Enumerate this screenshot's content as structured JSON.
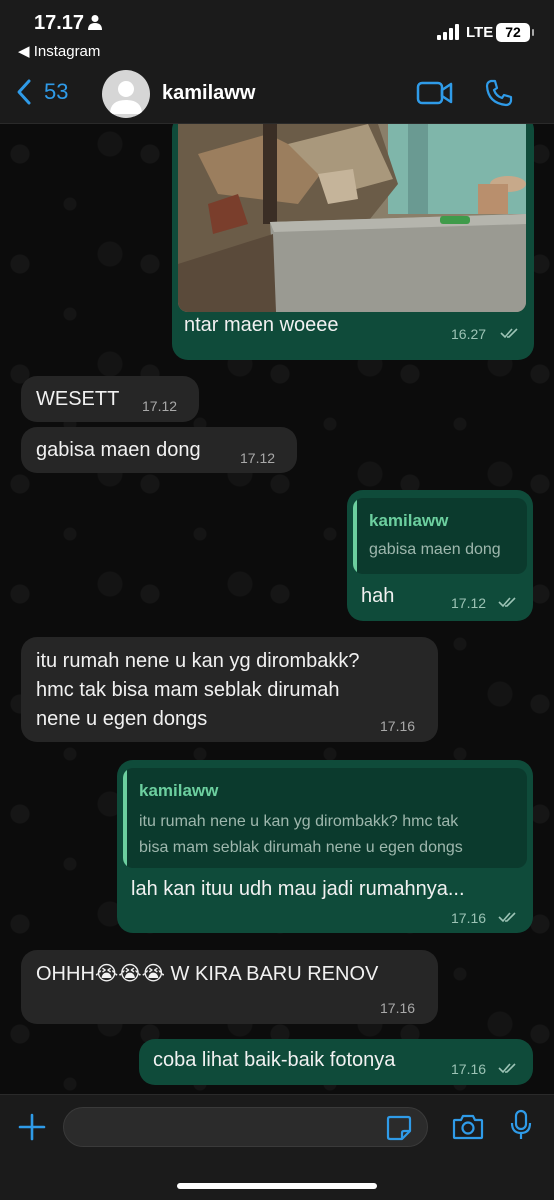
{
  "status_bar": {
    "time": "17.17",
    "back_app": "◀ Instagram",
    "network": "LTE",
    "battery": "72"
  },
  "header": {
    "back_count": "53",
    "contact_name": "kamilaww"
  },
  "messages": [
    {
      "direction": "out",
      "text": "ntar maen woeee",
      "time": "16.27",
      "has_photo": true
    },
    {
      "direction": "in",
      "text": "WESETT",
      "time": "17.12"
    },
    {
      "direction": "in",
      "text": "gabisa maen dong",
      "time": "17.12"
    },
    {
      "direction": "out",
      "text": "hah",
      "time": "17.12",
      "quote": {
        "author": "kamilaww",
        "text": "gabisa maen dong"
      }
    },
    {
      "direction": "in",
      "lines": [
        "itu rumah nene u kan yg dirombakk?",
        "hmc tak bisa mam seblak dirumah",
        "nene u egen dongs"
      ],
      "time": "17.16"
    },
    {
      "direction": "out",
      "text": "lah kan ituu udh mau jadi rumahnya...",
      "time": "17.16",
      "quote": {
        "author": "kamilaww",
        "lines": [
          "itu rumah nene u kan yg dirombakk? hmc tak",
          "bisa mam seblak dirumah nene u egen dongs"
        ]
      }
    },
    {
      "direction": "in",
      "text": "OHHH😭😭😭 W KIRA BARU RENOV",
      "time": "17.16"
    },
    {
      "direction": "out",
      "text": "coba lihat baik-baik fotonya",
      "time": "17.16"
    }
  ],
  "input": {
    "value": "",
    "placeholder": ""
  },
  "icons": {
    "back": "chevron-left-icon",
    "video": "video-call-icon",
    "phone": "phone-call-icon",
    "plus": "plus-icon",
    "sticker": "sticker-icon",
    "camera": "camera-icon",
    "mic": "microphone-icon"
  },
  "colors": {
    "accent_blue": "#2f9be8",
    "outgoing_bubble": "#0f4b3a",
    "incoming_bubble": "#262626",
    "quote_author": "#6ccf9f"
  }
}
